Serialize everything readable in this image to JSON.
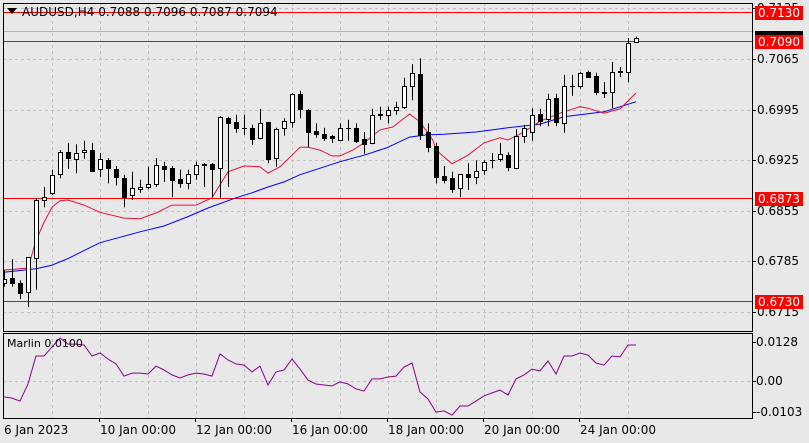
{
  "header": {
    "symbol": "AUDUSD,H4",
    "open": "0.7088",
    "high": "0.7096",
    "low": "0.7087",
    "close": "0.7094"
  },
  "indicator": {
    "title": "Marlin 0.0100",
    "axis_labels": [
      "0.0128",
      "0.00",
      "-0.0103"
    ],
    "axis_values": [
      0.0128,
      0,
      -0.0103
    ]
  },
  "price_axis": {
    "labels": [
      "0.7135",
      "0.7065",
      "0.6995",
      "0.6925",
      "0.6855",
      "0.6785",
      "0.6715"
    ],
    "values": [
      0.7135,
      0.7065,
      0.6995,
      0.6925,
      0.6855,
      0.6785,
      0.6715
    ]
  },
  "levels": [
    {
      "label": "0.7130",
      "value": 0.713
    },
    {
      "label": "0.7090",
      "value": 0.709
    },
    {
      "label": "0.6873",
      "value": 0.6873
    },
    {
      "label": "0.6730",
      "value": 0.673
    }
  ],
  "current_price": 0.7094,
  "time_axis": [
    {
      "label": "6 Jan 2023",
      "candle": 0
    },
    {
      "label": "10 Jan 00:00",
      "candle": 12
    },
    {
      "label": "12 Jan 00:00",
      "candle": 24
    },
    {
      "label": "16 Jan 00:00",
      "candle": 36
    },
    {
      "label": "18 Jan 00:00",
      "candle": 48
    },
    {
      "label": "20 Jan 00:00",
      "candle": 60
    },
    {
      "label": "24 Jan 00:00",
      "candle": 72
    }
  ],
  "colors": {
    "bull": "#ffffff",
    "bear": "#000000",
    "level": "#ff0000",
    "ma_fast": "#e8103c",
    "ma_slow": "#0000ff",
    "marlin": "#8b008b",
    "grid": "#c0c0c0"
  },
  "candles": [
    [
      0.6755,
      0.6773,
      0.675,
      0.6761
    ],
    [
      0.6762,
      0.6788,
      0.675,
      0.6755
    ],
    [
      0.6755,
      0.6759,
      0.6733,
      0.6741
    ],
    [
      0.6743,
      0.6791,
      0.6722,
      0.6791
    ],
    [
      0.679,
      0.6873,
      0.6746,
      0.687
    ],
    [
      0.687,
      0.6888,
      0.686,
      0.6874
    ],
    [
      0.688,
      0.6912,
      0.6877,
      0.6905
    ],
    [
      0.6906,
      0.6939,
      0.69,
      0.6936
    ],
    [
      0.6936,
      0.6949,
      0.6913,
      0.6928
    ],
    [
      0.6927,
      0.6947,
      0.6907,
      0.6935
    ],
    [
      0.6936,
      0.6952,
      0.6927,
      0.6939
    ],
    [
      0.6939,
      0.6949,
      0.6909,
      0.691
    ],
    [
      0.6913,
      0.6935,
      0.6902,
      0.6927
    ],
    [
      0.6925,
      0.6928,
      0.6893,
      0.6914
    ],
    [
      0.6913,
      0.6917,
      0.689,
      0.6902
    ],
    [
      0.69,
      0.6905,
      0.686,
      0.6874
    ],
    [
      0.6877,
      0.6909,
      0.687,
      0.6887
    ],
    [
      0.6885,
      0.6898,
      0.688,
      0.6888
    ],
    [
      0.6888,
      0.6916,
      0.6885,
      0.6892
    ],
    [
      0.6892,
      0.6928,
      0.6888,
      0.6918
    ],
    [
      0.6917,
      0.6923,
      0.6895,
      0.6913
    ],
    [
      0.6914,
      0.6917,
      0.6874,
      0.6898
    ],
    [
      0.6899,
      0.6912,
      0.6887,
      0.6893
    ],
    [
      0.6893,
      0.6912,
      0.6885,
      0.6906
    ],
    [
      0.6906,
      0.6923,
      0.6898,
      0.6918
    ],
    [
      0.6918,
      0.6921,
      0.6888,
      0.692
    ],
    [
      0.692,
      0.6921,
      0.6874,
      0.6913
    ],
    [
      0.6914,
      0.6986,
      0.6873,
      0.6985
    ],
    [
      0.6983,
      0.6985,
      0.6888,
      0.6976
    ],
    [
      0.6978,
      0.6988,
      0.6963,
      0.697
    ],
    [
      0.697,
      0.6988,
      0.696,
      0.6969
    ],
    [
      0.697,
      0.6974,
      0.6946,
      0.6954
    ],
    [
      0.6956,
      0.6996,
      0.6954,
      0.6976
    ],
    [
      0.6978,
      0.6978,
      0.6921,
      0.6927
    ],
    [
      0.6928,
      0.697,
      0.6916,
      0.6968
    ],
    [
      0.697,
      0.6983,
      0.6959,
      0.6979
    ],
    [
      0.6978,
      0.7018,
      0.697,
      0.7017
    ],
    [
      0.7017,
      0.7021,
      0.6983,
      0.6996
    ],
    [
      0.6995,
      0.6996,
      0.6943,
      0.6964
    ],
    [
      0.6965,
      0.6976,
      0.6956,
      0.6961
    ],
    [
      0.6961,
      0.697,
      0.6952,
      0.6956
    ],
    [
      0.6959,
      0.696,
      0.6949,
      0.6956
    ],
    [
      0.6953,
      0.6976,
      0.6952,
      0.697
    ],
    [
      0.697,
      0.6981,
      0.6952,
      0.6969
    ],
    [
      0.697,
      0.6976,
      0.6949,
      0.6952
    ],
    [
      0.6954,
      0.6964,
      0.6934,
      0.6947
    ],
    [
      0.6949,
      0.6996,
      0.6947,
      0.6988
    ],
    [
      0.6989,
      0.6999,
      0.6981,
      0.6988
    ],
    [
      0.6988,
      0.6999,
      0.6976,
      0.6995
    ],
    [
      0.6995,
      0.7006,
      0.6988,
      0.6999
    ],
    [
      0.6999,
      0.7039,
      0.6996,
      0.7028
    ],
    [
      0.7028,
      0.7058,
      0.7008,
      0.7046
    ],
    [
      0.7044,
      0.7066,
      0.6953,
      0.696
    ],
    [
      0.6964,
      0.6976,
      0.6936,
      0.6943
    ],
    [
      0.6945,
      0.6949,
      0.6893,
      0.6902
    ],
    [
      0.6903,
      0.6917,
      0.6893,
      0.6898
    ],
    [
      0.69,
      0.6909,
      0.688,
      0.6885
    ],
    [
      0.6887,
      0.6906,
      0.6874,
      0.6906
    ],
    [
      0.6906,
      0.6921,
      0.6884,
      0.6902
    ],
    [
      0.6902,
      0.6925,
      0.6892,
      0.691
    ],
    [
      0.6912,
      0.6925,
      0.6905,
      0.6923
    ],
    [
      0.6925,
      0.6935,
      0.6914,
      0.6925
    ],
    [
      0.6927,
      0.6949,
      0.6923,
      0.6934
    ],
    [
      0.6932,
      0.6936,
      0.691,
      0.6916
    ],
    [
      0.6914,
      0.6968,
      0.6914,
      0.6959
    ],
    [
      0.6959,
      0.6974,
      0.6949,
      0.697
    ],
    [
      0.6964,
      0.6997,
      0.6952,
      0.6988
    ],
    [
      0.6989,
      0.6996,
      0.6972,
      0.6979
    ],
    [
      0.6982,
      0.7017,
      0.6972,
      0.701
    ],
    [
      0.7011,
      0.7017,
      0.6972,
      0.6978
    ],
    [
      0.6976,
      0.7043,
      0.6963,
      0.7028
    ],
    [
      0.7028,
      0.7043,
      0.7014,
      0.7028
    ],
    [
      0.7028,
      0.7047,
      0.7024,
      0.7046
    ],
    [
      0.7047,
      0.7049,
      0.704,
      0.704
    ],
    [
      0.7042,
      0.7046,
      0.7015,
      0.7019
    ],
    [
      0.702,
      0.7033,
      0.7011,
      0.7018
    ],
    [
      0.7019,
      0.7061,
      0.6997,
      0.7047
    ],
    [
      0.7047,
      0.7054,
      0.704,
      0.7048
    ],
    [
      0.7047,
      0.7094,
      0.7033,
      0.7087
    ],
    [
      0.7088,
      0.7096,
      0.7087,
      0.7094
    ]
  ],
  "ma_fast": [
    [
      0,
      0.6773
    ],
    [
      3,
      0.6776
    ],
    [
      4,
      0.6814
    ],
    [
      5,
      0.6839
    ],
    [
      6,
      0.686
    ],
    [
      7,
      0.6869
    ],
    [
      8,
      0.687
    ],
    [
      10,
      0.6863
    ],
    [
      12,
      0.6853
    ],
    [
      15,
      0.6845
    ],
    [
      17,
      0.6844
    ],
    [
      19,
      0.6852
    ],
    [
      21,
      0.6863
    ],
    [
      24,
      0.6863
    ],
    [
      26,
      0.6873
    ],
    [
      28,
      0.6909
    ],
    [
      30,
      0.6917
    ],
    [
      32,
      0.6916
    ],
    [
      33,
      0.6907
    ],
    [
      34.5,
      0.6916
    ],
    [
      36,
      0.6932
    ],
    [
      37,
      0.6943
    ],
    [
      38,
      0.6943
    ],
    [
      39.5,
      0.6939
    ],
    [
      41,
      0.6931
    ],
    [
      42,
      0.6931
    ],
    [
      43.6,
      0.6939
    ],
    [
      45,
      0.6949
    ],
    [
      47,
      0.6967
    ],
    [
      48.6,
      0.6971
    ],
    [
      50.7,
      0.6989
    ],
    [
      52,
      0.6978
    ],
    [
      53.6,
      0.6953
    ],
    [
      54,
      0.6939
    ],
    [
      56,
      0.692
    ],
    [
      58,
      0.6932
    ],
    [
      60,
      0.6949
    ],
    [
      62,
      0.6956
    ],
    [
      63,
      0.6953
    ],
    [
      65,
      0.6964
    ],
    [
      67,
      0.6979
    ],
    [
      69.5,
      0.699
    ],
    [
      72,
      0.6999
    ],
    [
      73,
      0.6997
    ],
    [
      75,
      0.699
    ],
    [
      77,
      0.6996
    ],
    [
      79,
      0.7018
    ]
  ],
  "ma_slow": [
    [
      0,
      0.677
    ],
    [
      4,
      0.6775
    ],
    [
      6,
      0.678
    ],
    [
      8,
      0.6789
    ],
    [
      10,
      0.68
    ],
    [
      12,
      0.6811
    ],
    [
      15,
      0.682
    ],
    [
      17,
      0.6826
    ],
    [
      20,
      0.6834
    ],
    [
      23,
      0.6847
    ],
    [
      25.5,
      0.6859
    ],
    [
      29,
      0.6873
    ],
    [
      31,
      0.688
    ],
    [
      33,
      0.6888
    ],
    [
      35,
      0.6895
    ],
    [
      37,
      0.6905
    ],
    [
      39.5,
      0.6914
    ],
    [
      42,
      0.6923
    ],
    [
      45,
      0.6932
    ],
    [
      47.8,
      0.6942
    ],
    [
      50.7,
      0.6957
    ],
    [
      52.8,
      0.696
    ],
    [
      55,
      0.6961
    ],
    [
      59,
      0.6964
    ],
    [
      63,
      0.697
    ],
    [
      67,
      0.6975
    ],
    [
      70,
      0.6985
    ],
    [
      75,
      0.6992
    ],
    [
      79,
      0.7006
    ]
  ],
  "marlin": [
    -0.0052,
    -0.0056,
    -0.0066,
    -0.001,
    0.0082,
    0.0082,
    0.0112,
    0.0141,
    0.0121,
    0.0121,
    0.0118,
    0.0082,
    0.0092,
    0.0072,
    0.0056,
    0.0016,
    0.0026,
    0.0026,
    0.0023,
    0.0049,
    0.0036,
    0.002,
    0.001,
    0.002,
    0.0026,
    0.0023,
    0.0016,
    0.0089,
    0.0069,
    0.0056,
    0.0052,
    0.003,
    0.0049,
    -0.0013,
    0.003,
    0.0036,
    0.0072,
    0.0039,
    0.0003,
    -0.001,
    -0.0013,
    -0.0016,
    -0.0003,
    -0.001,
    -0.0026,
    -0.0033,
    0.0007,
    0.0007,
    0.0013,
    0.0016,
    0.0046,
    0.0059,
    -0.0036,
    -0.0059,
    -0.0102,
    -0.0098,
    -0.0112,
    -0.0082,
    -0.0082,
    -0.0066,
    -0.0049,
    -0.0039,
    -0.003,
    -0.0046,
    0.0007,
    0.002,
    0.0039,
    0.0033,
    0.0066,
    0.0023,
    0.0082,
    0.0082,
    0.0092,
    0.0085,
    0.0059,
    0.0052,
    0.0082,
    0.0079,
    0.0118,
    0.0118
  ]
}
